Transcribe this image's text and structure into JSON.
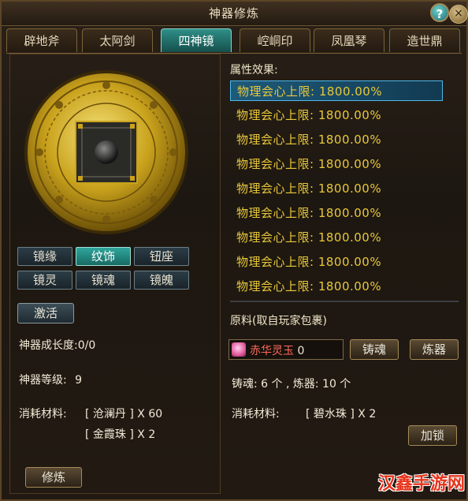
{
  "window": {
    "title": "神器修炼",
    "help_label": "?",
    "close_label": "×"
  },
  "tabs": [
    "辟地斧",
    "太阿剑",
    "四神镜",
    "崆峒印",
    "凤凰琴",
    "造世鼎"
  ],
  "active_tab": "四神镜",
  "left": {
    "sub_buttons": [
      "镜缘",
      "纹饰",
      "钮座",
      "镜灵",
      "镜魂",
      "镜魄"
    ],
    "activate_button": "激活",
    "growth_label": "神器成长度:",
    "growth_value": "0/0",
    "level_label": "神器等级:",
    "level_value": "9",
    "consume_label": "消耗材料:",
    "materials": [
      "[ 沧澜丹 ] X 60",
      "[ 金霞珠 ] X 2"
    ],
    "refine_button": "修炼"
  },
  "right": {
    "attr_title": "属性效果:",
    "attributes": [
      "物理会心上限: 1800.00%",
      "物理会心上限: 1800.00%",
      "物理会心上限: 1800.00%",
      "物理会心上限: 1800.00%",
      "物理会心上限: 1800.00%",
      "物理会心上限: 1800.00%",
      "物理会心上限: 1800.00%",
      "物理会心上限: 1800.00%",
      "物理会心上限: 1800.00%"
    ],
    "material_title": "原料(取自玩家包裹)",
    "item_name": "赤华灵玉",
    "item_count": "0",
    "cast_button": "铸魂",
    "forge_button": "炼器",
    "counts_text": "铸魂: 6 个 , 炼器: 10 个",
    "consume_label": "消耗材料:",
    "consume_value": "[ 碧水珠 ] X 2",
    "lock_button": "加锁"
  },
  "watermark": "汉鑫手游网"
}
